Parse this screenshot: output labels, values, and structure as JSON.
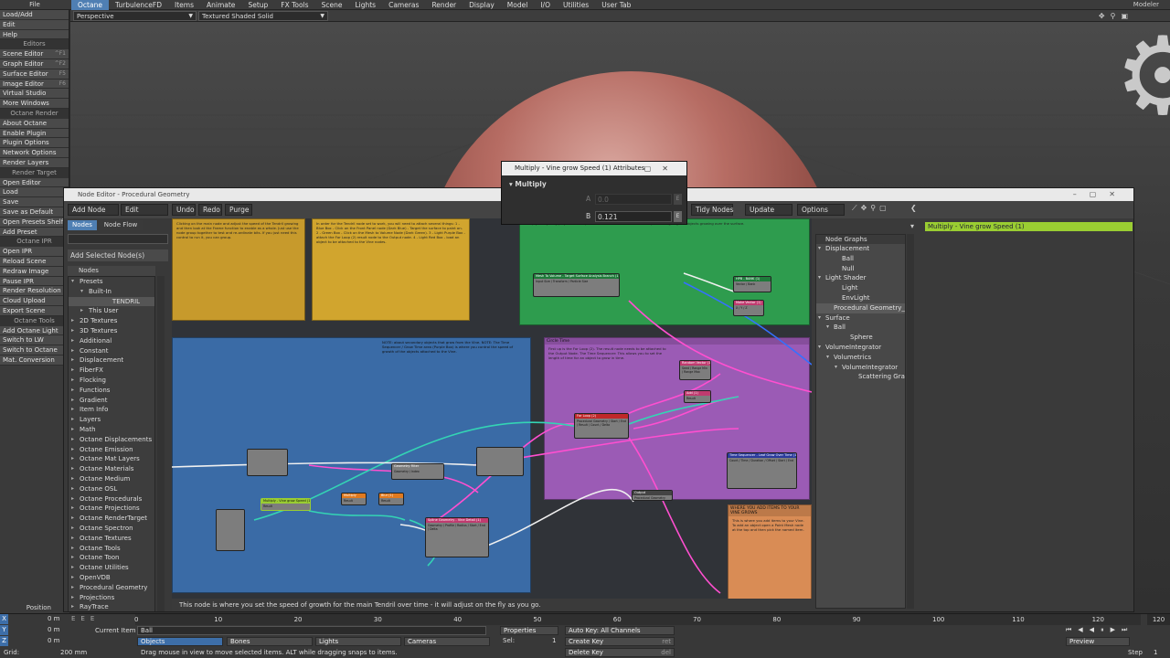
{
  "app": {
    "file_menu": "File",
    "modeler": "Modeler",
    "tabs": [
      "Octane",
      "TurbulenceFD",
      "Items",
      "Animate",
      "Setup",
      "FX Tools",
      "Scene",
      "Lights",
      "Cameras",
      "Render",
      "Display",
      "Model",
      "I/O",
      "Utilities",
      "User Tab"
    ],
    "active_tab": "Octane"
  },
  "sidebar": {
    "items": [
      {
        "label": "Load/Add",
        "type": "btn"
      },
      {
        "label": "Edit",
        "type": "btn"
      },
      {
        "label": "Help",
        "type": "btn"
      },
      {
        "label": "Editors",
        "type": "head"
      },
      {
        "label": "Scene Editor",
        "type": "btn",
        "shortcut": "^F1"
      },
      {
        "label": "Graph Editor",
        "type": "btn",
        "shortcut": "^F2"
      },
      {
        "label": "Surface Editor",
        "type": "btn",
        "shortcut": "F5"
      },
      {
        "label": "Image Editor",
        "type": "btn",
        "shortcut": "F6"
      },
      {
        "label": "Virtual Studio",
        "type": "btn"
      },
      {
        "label": "More Windows",
        "type": "btn"
      },
      {
        "label": "Octane Render",
        "type": "head"
      },
      {
        "label": "About Octane",
        "type": "btn"
      },
      {
        "label": "Enable Plugin",
        "type": "btn"
      },
      {
        "label": "Plugin Options",
        "type": "btn"
      },
      {
        "label": "Network Options",
        "type": "btn"
      },
      {
        "label": "Render Layers",
        "type": "btn"
      },
      {
        "label": "Render Target",
        "type": "head"
      },
      {
        "label": "Open Editor",
        "type": "btn"
      },
      {
        "label": "Load",
        "type": "btn"
      },
      {
        "label": "Save",
        "type": "btn"
      },
      {
        "label": "Save as Default",
        "type": "btn"
      },
      {
        "label": "Open Presets Shelf",
        "type": "btn"
      },
      {
        "label": "Add Preset",
        "type": "btn"
      },
      {
        "label": "Octane IPR",
        "type": "head"
      },
      {
        "label": "Open IPR",
        "type": "btn"
      },
      {
        "label": "Reload Scene",
        "type": "btn"
      },
      {
        "label": "Redraw Image",
        "type": "btn"
      },
      {
        "label": "Pause IPR",
        "type": "btn"
      },
      {
        "label": "Render Resolution",
        "type": "btn"
      },
      {
        "label": "Cloud Upload",
        "type": "btn"
      },
      {
        "label": "Export Scene",
        "type": "btn"
      },
      {
        "label": "Octane Tools",
        "type": "head"
      },
      {
        "label": "Add Octane Light",
        "type": "btn"
      },
      {
        "label": "Switch to LW",
        "type": "btn"
      },
      {
        "label": "Switch to Octane",
        "type": "btn"
      },
      {
        "label": "Mat. Conversion",
        "type": "btn"
      }
    ],
    "position_label": "Position"
  },
  "viewport": {
    "view_mode": "Perspective",
    "shading_mode": "Textured Shaded Solid"
  },
  "node_editor": {
    "title": "Node Editor - Procedural Geometry",
    "toolbar": [
      "Add Node",
      "Edit",
      "Undo",
      "Redo",
      "Purge"
    ],
    "right_toolbar": [
      "Tidy Nodes",
      "Update",
      "Options"
    ],
    "tabs": [
      "Nodes",
      "Node Flow"
    ],
    "add_selected": "Add Selected Node(s)",
    "tree_header": "Nodes",
    "tree": [
      {
        "label": "Presets",
        "depth": 0,
        "open": true
      },
      {
        "label": "Built-In",
        "depth": 1,
        "open": true
      },
      {
        "label": "TENDRIL",
        "depth": 2,
        "sel": true
      },
      {
        "label": "This User",
        "depth": 1,
        "open": false
      },
      {
        "label": "2D Textures",
        "depth": 0
      },
      {
        "label": "3D Textures",
        "depth": 0
      },
      {
        "label": "Additional",
        "depth": 0
      },
      {
        "label": "Constant",
        "depth": 0
      },
      {
        "label": "Displacement",
        "depth": 0
      },
      {
        "label": "FiberFX",
        "depth": 0
      },
      {
        "label": "Flocking",
        "depth": 0
      },
      {
        "label": "Functions",
        "depth": 0
      },
      {
        "label": "Gradient",
        "depth": 0
      },
      {
        "label": "Item Info",
        "depth": 0
      },
      {
        "label": "Layers",
        "depth": 0
      },
      {
        "label": "Math",
        "depth": 0
      },
      {
        "label": "Octane Displacements",
        "depth": 0
      },
      {
        "label": "Octane Emission",
        "depth": 0
      },
      {
        "label": "Octane Mat Layers",
        "depth": 0
      },
      {
        "label": "Octane Materials",
        "depth": 0
      },
      {
        "label": "Octane Medium",
        "depth": 0
      },
      {
        "label": "Octane OSL",
        "depth": 0
      },
      {
        "label": "Octane Procedurals",
        "depth": 0
      },
      {
        "label": "Octane Projections",
        "depth": 0
      },
      {
        "label": "Octane RenderTarget",
        "depth": 0
      },
      {
        "label": "Octane Spectron",
        "depth": 0
      },
      {
        "label": "Octane Textures",
        "depth": 0
      },
      {
        "label": "Octane Tools",
        "depth": 0
      },
      {
        "label": "Octane Toon",
        "depth": 0
      },
      {
        "label": "Octane Utilities",
        "depth": 0
      },
      {
        "label": "OpenVDB",
        "depth": 0
      },
      {
        "label": "Procedural Geometry",
        "depth": 0
      },
      {
        "label": "Projections",
        "depth": 0
      },
      {
        "label": "RayTrace",
        "depth": 0
      }
    ],
    "status_text": "This node is where you set the speed of growth for the main Tendril over time - it will adjust on the fly as you go.",
    "selected_node_label": "Multiply - Vine grow Speed (1)",
    "node_graphs_header": "Node Graphs",
    "node_graphs": [
      {
        "label": "Displacement",
        "depth": 0,
        "caret": "open"
      },
      {
        "label": "Ball",
        "depth": 2
      },
      {
        "label": "Null",
        "depth": 2
      },
      {
        "label": "Light Shader",
        "depth": 0,
        "caret": "open"
      },
      {
        "label": "Light",
        "depth": 2
      },
      {
        "label": "EnvLight",
        "depth": 2
      },
      {
        "label": "Procedural Geometry_Nu",
        "depth": 1,
        "sel": true
      },
      {
        "label": "Surface",
        "depth": 0,
        "caret": "open"
      },
      {
        "label": "Ball",
        "depth": 1,
        "caret": "open"
      },
      {
        "label": "Sphere",
        "depth": 3
      },
      {
        "label": "VolumeIntegrator",
        "depth": 0,
        "caret": "open"
      },
      {
        "label": "Volumetrics",
        "depth": 1,
        "caret": "open"
      },
      {
        "label": "VolumeIntegrator",
        "depth": 2,
        "caret": "open"
      },
      {
        "label": "Scattering Grapl",
        "depth": 4
      }
    ],
    "canvas": {
      "groups": [
        {
          "id": "yellow",
          "title": "",
          "text": "Clicking on the main node and adjust the speed of the Tendril growing and then look at the Frame function to enable as a whole. Just use the node group together to test and re-ordinate bits. If you just need this control to run it, you can group.",
          "color": "#c79a2c"
        },
        {
          "id": "yellow2",
          "title": "",
          "text": "In order for the Tendril node set to work, you will need to attach several things: 1 - Blue Box - Click on the Front Panel node (Dark Blue) - Target the surface to paint on. 2 - Green Box - Click on the Mesh to Volume Node (Dark Green). 3 - Light Purple Box - attach the For Loop (2) result node to the Output node. 4 - Light Red Box - load an object to be attached to the Vine nodes.",
          "color": "#d1a52e"
        },
        {
          "id": "green",
          "title": "",
          "text": "Multiply everything plays back the place. The Blank function can also help when aligning the objects growing over the surface.",
          "color": "#2e9c4e"
        },
        {
          "id": "blue",
          "title": "",
          "text": "NOTE: about secondary objects that grow from the Vine. NOTE: The Time Sequencer / Grow Time area (Purple Box) is where you control the speed of growth of the objects attached to the Vine.",
          "color": "#3a6ba6"
        },
        {
          "id": "purple",
          "title": "Circle Time",
          "text": "First up is the For Loop (2). The result node needs to be attached to the Output Node. The Time Sequencer: This allows you to set the length of time for an object to grow in time.",
          "color": "#9b5bb5"
        },
        {
          "id": "orange",
          "title": "WHERE YOU ADD ITEMS TO YOUR VINE GROWS",
          "text": "This is where you add items to your Vine. To add an object open a Point Mesh node at the top and then pick the named item.",
          "color": "#d98c55"
        }
      ],
      "nodes": [
        {
          "title": "Mesh To Volume - Target Surface Analysis Branch (1)",
          "color": "#1e7a3a",
          "body": "Input Size / Transform / Particle Size"
        },
        {
          "title": "For Loop (2)",
          "color": "#c0282a",
          "body": "Procedural Geometry / Start / End / Result / Count / Delta"
        },
        {
          "title": "Time Sequencer - Leaf Grow Over Time (1)",
          "color": "#2a3a9c",
          "body": "Count / Time / Duration / Offset / Start / End"
        },
        {
          "title": "Spline Geometry - Vine Detail (1)",
          "color": "#c03b6f",
          "body": "Geometry / Profile / Radius / Start / End / Delta"
        },
        {
          "title": "Multiply - Vine grow Speed (1)",
          "color": "#9acd32",
          "body": "Result"
        },
        {
          "title": "Multiply",
          "color": "#e07a1f",
          "body": "Result"
        },
        {
          "title": "Blur (1)",
          "color": "#e07a1f",
          "body": "Result"
        },
        {
          "title": "Random Vector (1)",
          "color": "#c03b6f",
          "body": "Seed / Range Min / Range Max"
        },
        {
          "title": "Add (1)",
          "color": "#c03b6f",
          "body": "Result"
        },
        {
          "title": "HPB - BANK (1)",
          "color": "#1e7a3a",
          "body": "Vector / Bank"
        },
        {
          "title": "Make Vector (1)",
          "color": "#c03b6f",
          "body": "X / Y / Z"
        },
        {
          "title": "Geometry Filter",
          "color": "#7d7d7d",
          "body": "Geometry / Index"
        },
        {
          "title": "Output",
          "color": "#444",
          "body": "Procedural Geometry"
        }
      ]
    }
  },
  "multiply_dialog": {
    "title": "Multiply - Vine grow Speed (1) Attributes",
    "section": "Multiply",
    "a_label": "A",
    "a_value": "0.0",
    "b_label": "B",
    "b_value": "0.121"
  },
  "timeline": {
    "ticks": [
      "0",
      "10",
      "20",
      "30",
      "40",
      "50",
      "60",
      "70",
      "80",
      "90",
      "100",
      "110",
      "120"
    ],
    "end_frame": "120",
    "x_value": "0 m",
    "y_value": "0 m",
    "z_value": "0 m",
    "grid_label": "Grid:",
    "grid_value": "200 mm",
    "current_item_label": "Current Item",
    "current_item": "Ball",
    "objects": "Objects",
    "bones": "Bones",
    "lights": "Lights",
    "cameras": "Cameras",
    "properties": "Properties",
    "sel_label": "Sel:",
    "sel_value": "1",
    "auto_key": "Auto Key: All Channels",
    "create_key": "Create Key",
    "delete_key": "Delete Key",
    "create_key_sc": "ret",
    "delete_key_sc": "del",
    "preview": "Preview",
    "step_label": "Step",
    "step_value": "1",
    "status": "Drag mouse in view to move selected items. ALT while dragging snaps to items."
  }
}
